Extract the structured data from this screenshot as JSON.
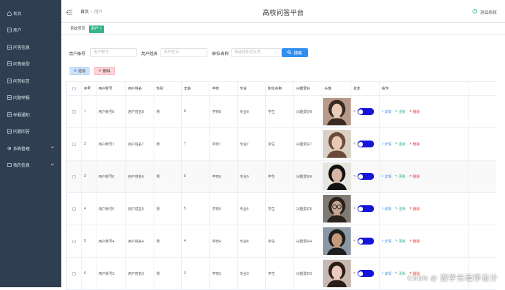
{
  "sidebar": {
    "items": [
      {
        "label": "首页",
        "icon": "home-icon"
      },
      {
        "label": "用户",
        "icon": "grid-icon"
      },
      {
        "label": "问答信息",
        "icon": "grid-icon"
      },
      {
        "label": "问答类型",
        "icon": "grid-icon"
      },
      {
        "label": "问答标签",
        "icon": "grid-icon"
      },
      {
        "label": "问题举报",
        "icon": "grid-icon"
      },
      {
        "label": "举报通知",
        "icon": "grid-icon"
      },
      {
        "label": "问题回答",
        "icon": "grid-icon"
      },
      {
        "label": "系统管理",
        "icon": "gear-icon",
        "expandable": true
      },
      {
        "label": "我的信息",
        "icon": "card-icon",
        "expandable": true
      }
    ]
  },
  "header": {
    "breadcrumb": [
      "首页",
      "用户"
    ],
    "title": "高校问答平台",
    "logout": "退出系统"
  },
  "tags": [
    "系统首页",
    "用户 ×"
  ],
  "search": {
    "fields": [
      {
        "label": "用户账号",
        "placeholder": "用户账号"
      },
      {
        "label": "用户姓名",
        "placeholder": "用户姓名"
      },
      {
        "label": "职位名称",
        "placeholder": "请选择职位名称"
      }
    ],
    "button": "搜索"
  },
  "actions": {
    "add": "增加",
    "delete": "删除"
  },
  "table": {
    "columns": [
      "",
      "序号",
      "用户账号",
      "用户姓名",
      "性别",
      "年龄",
      "学校",
      "专业",
      "职位名称",
      "兴趣爱好",
      "头像",
      "状态",
      "操作"
    ],
    "rows": [
      {
        "idx": "1",
        "account": "用户账号8",
        "name": "用户姓名8",
        "gender": "男",
        "age": "8",
        "school": "学校8",
        "major": "专业8",
        "position": "学生",
        "hobby": "兴趣爱好8"
      },
      {
        "idx": "2",
        "account": "用户账号7",
        "name": "用户姓名7",
        "gender": "男",
        "age": "7",
        "school": "学校7",
        "major": "专业7",
        "position": "学生",
        "hobby": "兴趣爱好7"
      },
      {
        "idx": "3",
        "account": "用户账号6",
        "name": "用户姓名6",
        "gender": "男",
        "age": "6",
        "school": "学校6",
        "major": "专业6",
        "position": "学生",
        "hobby": "兴趣爱好6"
      },
      {
        "idx": "4",
        "account": "用户账号5",
        "name": "用户姓名5",
        "gender": "男",
        "age": "5",
        "school": "学校5",
        "major": "专业5",
        "position": "学生",
        "hobby": "兴趣爱好5"
      },
      {
        "idx": "5",
        "account": "用户账号4",
        "name": "用户姓名4",
        "gender": "男",
        "age": "4",
        "school": "学校4",
        "major": "专业4",
        "position": "学生",
        "hobby": "兴趣爱好4"
      },
      {
        "idx": "6",
        "account": "用户账号3",
        "name": "用户姓名3",
        "gender": "男",
        "age": "3",
        "school": "学校3",
        "major": "专业3",
        "position": "学生",
        "hobby": "兴趣爱好3"
      }
    ],
    "ops": {
      "detail": "详情",
      "update": "更新",
      "delete": "删除"
    }
  },
  "watermark": {
    "brand": "CSDN @",
    "author": "迦学长程序设计"
  },
  "colors": {
    "sidebar": "#2f3e50",
    "accent": "#2f8ef0",
    "tag": "#35b58c",
    "toggle": "#1515d8",
    "danger": "#e4393c"
  }
}
